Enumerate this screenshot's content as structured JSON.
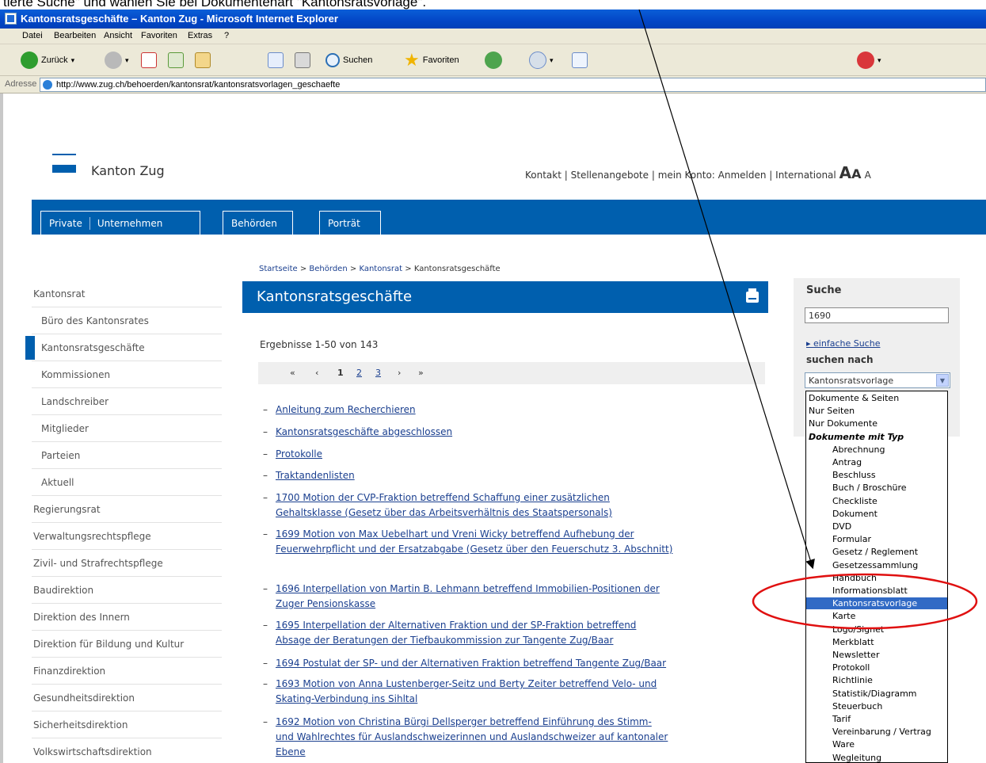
{
  "caption": "tierte Suche\" und wählen Sie bei Dokumentenart \"Kantonsratsvorlage\".",
  "browser": {
    "title": "Kantonsratsgeschäfte – Kanton Zug - Microsoft Internet Explorer",
    "menu": [
      "Datei",
      "Bearbeiten",
      "Ansicht",
      "Favoriten",
      "Extras",
      "?"
    ],
    "toolbar": {
      "back": "Zurück",
      "search": "Suchen",
      "favorites": "Favoriten"
    },
    "address_label": "Adresse",
    "url": "http://www.zug.ch/behoerden/kantonsrat/kantonsratsvorlagen_geschaefte"
  },
  "site": {
    "name": "Kanton Zug",
    "toplinks": [
      "Kontakt",
      "Stellenangebote",
      "mein Konto: Anmelden",
      "International"
    ],
    "font_sizes": [
      "A",
      "A",
      "A"
    ],
    "nav": {
      "private": "Private",
      "unternehmen": "Unternehmen",
      "behoerden": "Behörden",
      "portraet": "Porträt"
    },
    "breadcrumb": [
      "Startseite",
      "Behörden",
      "Kantonsrat",
      "Kantonsratsgeschäfte"
    ],
    "breadcrumb_sep": ">"
  },
  "leftnav": [
    "Kantonsrat",
    "Büro des Kantonsrates",
    "Kantonsratsgeschäfte",
    "Kommissionen",
    "Landschreiber",
    "Mitglieder",
    "Parteien",
    "Aktuell",
    "Regierungsrat",
    "Verwaltungsrechtspflege",
    "Zivil- und Strafrechtspflege",
    "Baudirektion",
    "Direktion des Innern",
    "Direktion für Bildung und Kultur",
    "Finanzdirektion",
    "Gesundheitsdirektion",
    "Sicherheitsdirektion",
    "Volkswirtschaftsdirektion"
  ],
  "main": {
    "title": "Kantonsratsgeschäfte",
    "results": "Ergebnisse 1-50 von 143",
    "pager": {
      "first": "«",
      "prev": "‹",
      "pages": [
        "1",
        "2",
        "3"
      ],
      "next": "›",
      "last": "»"
    },
    "items": [
      [
        "Anleitung zum Recherchieren"
      ],
      [
        "Kantonsratsgeschäfte abgeschlossen"
      ],
      [
        "Protokolle"
      ],
      [
        "Traktandenlisten"
      ],
      [
        "1700 Motion der CVP-Fraktion betreffend Schaffung einer zusätzlichen",
        "Gehaltsklasse (Gesetz über das Arbeitsverhältnis des Staatspersonals)"
      ],
      [
        "1699 Motion von Max Uebelhart und Vreni Wicky betreffend Aufhebung der",
        "Feuerwehrpflicht und der Ersatzabgabe (Gesetz über den Feuerschutz 3. Abschnitt)"
      ],
      [
        "1696 Interpellation von Martin B. Lehmann betreffend Immobilien-Positionen der",
        "Zuger Pensionskasse"
      ],
      [
        "1695 Interpellation der Alternativen Fraktion und der SP-Fraktion betreffend",
        "Absage der Beratungen der Tiefbaukommission zur Tangente Zug/Baar"
      ],
      [
        "1694 Postulat der SP- und der Alternativen Fraktion betreffend Tangente Zug/Baar"
      ],
      [
        "1693 Motion von Anna Lustenberger-Seitz und Berty Zeiter betreffend Velo- und",
        "Skating-Verbindung ins Sihltal"
      ],
      [
        "1692 Motion von Christina Bürgi Dellsperger betreffend Einführung des Stimm-",
        "und Wahlrechtes für Auslandschweizerinnen und Auslandschweizer auf kantonaler",
        "Ebene"
      ]
    ]
  },
  "search": {
    "heading": "Suche",
    "value": "1690",
    "simple_link": "einfache Suche",
    "search_by": "suchen nach",
    "selected": "Kantonsratsvorlage",
    "options": [
      {
        "label": "Dokumente & Seiten",
        "kind": "top"
      },
      {
        "label": "Nur Seiten",
        "kind": "top"
      },
      {
        "label": "Nur Dokumente",
        "kind": "top"
      },
      {
        "label": "Dokumente mit Typ",
        "kind": "group"
      },
      {
        "label": "Abrechnung",
        "kind": "sub"
      },
      {
        "label": "Antrag",
        "kind": "sub"
      },
      {
        "label": "Beschluss",
        "kind": "sub"
      },
      {
        "label": "Buch / Broschüre",
        "kind": "sub"
      },
      {
        "label": "Checkliste",
        "kind": "sub"
      },
      {
        "label": "Dokument",
        "kind": "sub"
      },
      {
        "label": "DVD",
        "kind": "sub"
      },
      {
        "label": "Formular",
        "kind": "sub"
      },
      {
        "label": "Gesetz / Reglement",
        "kind": "sub"
      },
      {
        "label": "Gesetzessammlung",
        "kind": "sub"
      },
      {
        "label": "Handbuch",
        "kind": "sub"
      },
      {
        "label": "Informationsblatt",
        "kind": "sub"
      },
      {
        "label": "Kantonsratsvorlage",
        "kind": "sub",
        "selected": true
      },
      {
        "label": "Karte",
        "kind": "sub"
      },
      {
        "label": "Logo/Signet",
        "kind": "sub"
      },
      {
        "label": "Merkblatt",
        "kind": "sub"
      },
      {
        "label": "Newsletter",
        "kind": "sub"
      },
      {
        "label": "Protokoll",
        "kind": "sub"
      },
      {
        "label": "Richtlinie",
        "kind": "sub"
      },
      {
        "label": "Statistik/Diagramm",
        "kind": "sub"
      },
      {
        "label": "Steuerbuch",
        "kind": "sub"
      },
      {
        "label": "Tarif",
        "kind": "sub"
      },
      {
        "label": "Vereinbarung / Vertrag",
        "kind": "sub"
      },
      {
        "label": "Ware",
        "kind": "sub"
      },
      {
        "label": "Wegleitung",
        "kind": "sub"
      }
    ]
  },
  "colors": {
    "brand": "#005fae",
    "link": "#1a3f8f",
    "annotation": "#e01010",
    "selection": "#316ac5"
  }
}
